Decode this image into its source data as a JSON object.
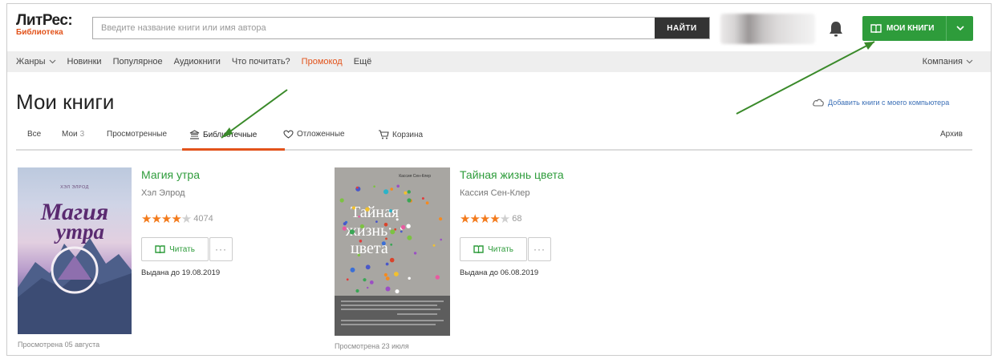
{
  "header": {
    "logo_main": "ЛитРес:",
    "logo_sub": "Библиотека",
    "search_placeholder": "Введите название книги или имя автора",
    "search_button": "НАЙТИ",
    "my_books_button": "МОИ КНИГИ"
  },
  "nav": {
    "items": [
      "Жанры",
      "Новинки",
      "Популярное",
      "Аудиокниги",
      "Что почитать?",
      "Промокод",
      "Ещё"
    ],
    "right": "Компания"
  },
  "page": {
    "title": "Мои книги",
    "add_link": "Добавить книги с моего компьютера"
  },
  "tabs": {
    "all": "Все",
    "mine": "Мои",
    "mine_count": "3",
    "viewed": "Просмотренные",
    "library": "Библиотечные",
    "postponed": "Отложенные",
    "cart": "Корзина",
    "archive": "Архив"
  },
  "books": [
    {
      "title": "Магия утра",
      "author": "Хэл Элрод",
      "rating_count": "4074",
      "stars_filled": 4,
      "read_label": "Читать",
      "more_label": "···",
      "issued": "Выдана до 19.08.2019",
      "viewed": "Просмотрена 05 августа",
      "cover_author": "ХЭЛ ЭЛРОД",
      "cover_title_1": "Магия",
      "cover_title_2": "утра"
    },
    {
      "title": "Тайная жизнь цвета",
      "author": "Кассия Сен-Клер",
      "rating_count": "68",
      "stars_filled": 4,
      "read_label": "Читать",
      "more_label": "···",
      "issued": "Выдана до 06.08.2019",
      "viewed": "Просмотрена 23 июля",
      "cover_author": "Кассия Сен-Клер",
      "cover_title_1": "Тайная",
      "cover_title_2": "жизнь",
      "cover_title_3": "цвета"
    }
  ],
  "colors": {
    "brand_green": "#2e9c3b",
    "accent_orange": "#e2531b",
    "annotation_arrow": "#3a8a2a"
  }
}
